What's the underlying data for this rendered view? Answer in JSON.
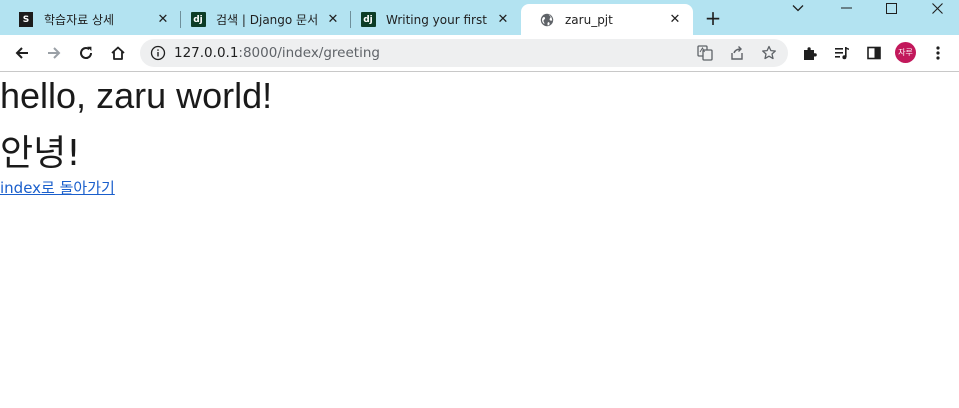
{
  "browser": {
    "tabs": [
      {
        "title": "학습자료 상세",
        "favicon": "s-icon",
        "active": false
      },
      {
        "title": "검색 | Django 문서",
        "favicon": "django-icon",
        "active": false
      },
      {
        "title": "Writing your first D",
        "favicon": "django-icon",
        "active": false
      },
      {
        "title": "zaru_pjt",
        "favicon": "globe-icon",
        "active": true
      }
    ],
    "favicon_text": {
      "s": "S",
      "dj": "dj"
    },
    "new_tab_label": "+",
    "address": {
      "host": "127.0.0.1",
      "path": ":8000/index/greeting"
    },
    "profile_initials": "자루",
    "colors": {
      "tabstrip_bg": "#b3e3f1",
      "profile_bg": "#c2185b",
      "link": "#1a5fcc"
    }
  },
  "page": {
    "heading": "hello, zaru world!",
    "subheading": "안녕!",
    "back_link": "index로 돌아가기"
  }
}
